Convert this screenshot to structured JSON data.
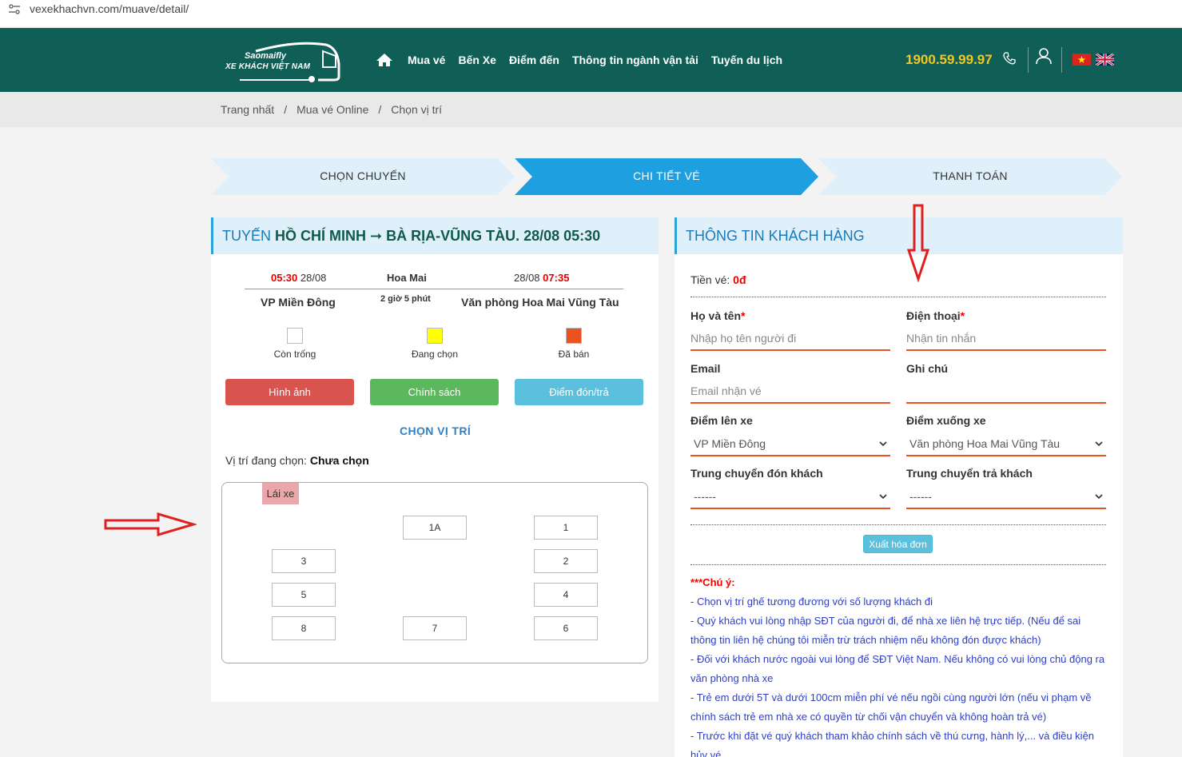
{
  "browser": {
    "url": "vexekhachvn.com/muave/detail/"
  },
  "header": {
    "logo_top": "Saomaifly",
    "logo_bottom": "XE KHÁCH VIỆT NAM",
    "nav": [
      "Mua vé",
      "Bến Xe",
      "Điểm đến",
      "Thông tin ngành vận tải",
      "Tuyến du lịch"
    ],
    "hotline": "1900.59.99.97"
  },
  "breadcrumb": [
    "Trang nhất",
    "Mua vé Online",
    "Chọn vị trí"
  ],
  "steps": [
    "CHỌN CHUYẾN",
    "CHI TIẾT VÉ",
    "THANH TOÁN"
  ],
  "trip": {
    "title_prefix": "TUYẾN",
    "title_route": "HỒ CHÍ MINH ➞ BÀ RỊA-VŨNG TÀU",
    "title_time": ". 28/08 05:30",
    "depart_time": "05:30",
    "depart_date": "28/08",
    "operator": "Hoa Mai",
    "arrive_date": "28/08",
    "arrive_time": "07:35",
    "from": "VP Miền Đông",
    "duration": "2 giờ 5 phút",
    "to": "Văn phòng Hoa Mai Vũng Tàu"
  },
  "legend": [
    {
      "label": "Còn trống",
      "color": "#ffffff"
    },
    {
      "label": "Đang chọn",
      "color": "#ffff00"
    },
    {
      "label": "Đã bán",
      "color": "#e8531f"
    }
  ],
  "buttons": {
    "images": "Hình ảnh",
    "policy": "Chính sách",
    "pickup": "Điểm đón/trả"
  },
  "seat_section": {
    "title": "CHỌN VỊ TRÍ",
    "current_label": "Vị trí đang chọn:",
    "current_value": "Chưa chọn",
    "driver": "Lái xe",
    "seats": [
      "1A",
      "1",
      "3",
      "2",
      "5",
      "4",
      "8",
      "7",
      "6"
    ]
  },
  "customer": {
    "title": "THÔNG TIN KHÁCH HÀNG",
    "price_label": "Tiền vé:",
    "price_value": "0đ",
    "name_label": "Họ và tên",
    "name_placeholder": "Nhập họ tên người đi",
    "phone_label": "Điện thoại",
    "phone_placeholder": "Nhận tin nhắn",
    "email_label": "Email",
    "email_placeholder": "Email nhận vé",
    "note_label": "Ghi chú",
    "board_label": "Điểm lên xe",
    "board_value": "VP Miền Đông",
    "alight_label": "Điểm xuống xe",
    "alight_value": "Văn phòng Hoa Mai Vũng Tàu",
    "transfer_pick_label": "Trung chuyển đón khách",
    "transfer_pick_value": "------",
    "transfer_drop_label": "Trung chuyển trả khách",
    "transfer_drop_value": "------",
    "invoice_button": "Xuất hóa đơn",
    "notes_title": "***Chú ý:",
    "notes": [
      "- Chọn vị trí ghế tương đương với số lượng khách đi",
      "- Quý khách vui lòng nhập SĐT của người đi, để nhà xe liên hệ trực tiếp. (Nếu để sai thông tin liên hệ chúng tôi miễn trừ trách nhiệm nếu không đón được khách)",
      "- Đối với khách nước ngoài vui lòng để SĐT Việt Nam. Nếu không có vui lòng chủ động ra văn phòng nhà xe",
      "- Trẻ em dưới 5T và dưới 100cm miễn phí vé nếu ngồi cùng người lớn (nếu vi phạm về chính sách trẻ em nhà xe có quyền từ chối vận chuyển và không hoàn trả vé)",
      "- Trước khi đặt vé quý khách tham khảo chính sách về thú cưng, hành lý,... và điều kiện hủy vé"
    ]
  },
  "colors": {
    "header_bg": "#0f5f56",
    "accent_blue": "#1e9fe0",
    "hotline": "#f3c623",
    "btn_red": "#d9534f",
    "btn_green": "#5cb85c",
    "btn_cyan": "#5bc0de",
    "underline_orange": "#e8531f",
    "annotation_arrow": "#e02020"
  }
}
